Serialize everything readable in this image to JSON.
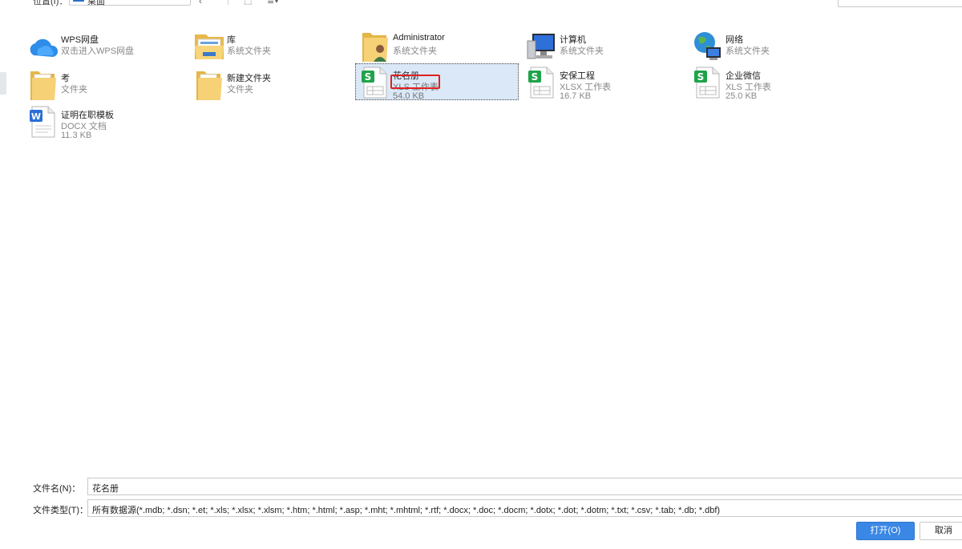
{
  "toolbar": {
    "location_label": "位置(I)：",
    "location_value": "桌面"
  },
  "files": [
    {
      "name": "WPS网盘",
      "type": "双击进入WPS网盘",
      "size": "",
      "icon": "cloud-icon"
    },
    {
      "name": "库",
      "type": "系统文件夹",
      "size": "",
      "icon": "library-folder-icon"
    },
    {
      "name": "Administrator",
      "type": "系统文件夹",
      "size": "",
      "icon": "user-folder-icon"
    },
    {
      "name": "计算机",
      "type": "系统文件夹",
      "size": "",
      "icon": "computer-icon"
    },
    {
      "name": "网络",
      "type": "系统文件夹",
      "size": "",
      "icon": "network-globe-icon"
    },
    {
      "name": "考",
      "type": "文件夹",
      "size": "",
      "icon": "folder-icon"
    },
    {
      "name": "新建文件夹",
      "type": "文件夹",
      "size": "",
      "icon": "folder-icon"
    },
    {
      "name": "花名册",
      "type": "XLS 工作表",
      "size": "54.0 KB",
      "icon": "spreadsheet-icon",
      "selected": true
    },
    {
      "name": "安保工程",
      "type": "XLSX 工作表",
      "size": "16.7 KB",
      "icon": "spreadsheet-icon"
    },
    {
      "name": "企业微信",
      "type": "XLS 工作表",
      "size": "25.0 KB",
      "icon": "spreadsheet-icon"
    },
    {
      "name": "证明在职模板",
      "type": "DOCX 文档",
      "size": "11.3 KB",
      "icon": "word-doc-icon"
    }
  ],
  "form": {
    "filename_label": "文件名(N)：",
    "filename_value": "花名册",
    "filetype_label": "文件类型(T)：",
    "filetype_value": "所有数据源(*.mdb; *.dsn; *.et; *.xls; *.xlsx; *.xlsm; *.htm; *.html; *.asp; *.mht; *.mhtml; *.rtf; *.docx; *.doc; *.docm; *.dotx; *.dot; *.dotm; *.txt; *.csv; *.tab; *.db; *.dbf)"
  },
  "buttons": {
    "open_label": "打开(O)",
    "cancel_label": "取消"
  },
  "colors": {
    "accent": "#3a87e6",
    "selection_bg": "#dbe8f7",
    "highlight_box": "#e02020",
    "spreadsheet_green": "#1fa34a",
    "word_blue": "#2b6fd6",
    "folder_yellow": "#f3cf6b"
  }
}
